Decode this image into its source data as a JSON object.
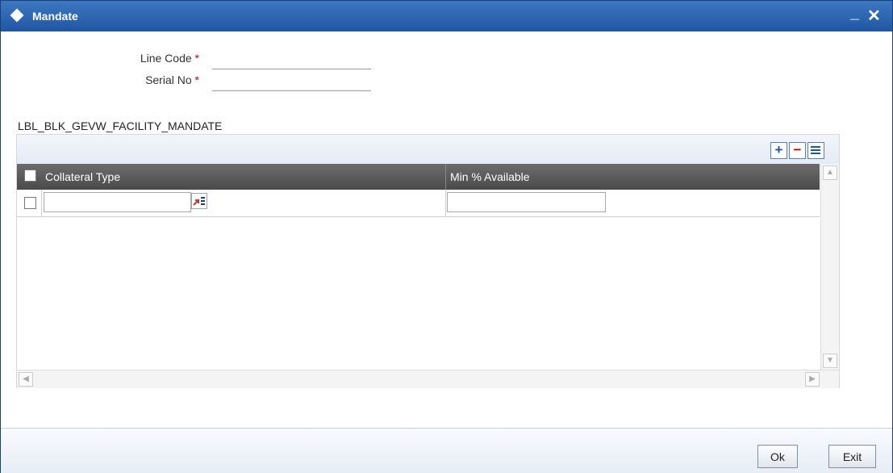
{
  "window": {
    "title": "Mandate",
    "minimize_glyph": "_",
    "close_glyph": "✕"
  },
  "form": {
    "line_code_label": "Line Code",
    "line_code_value": "",
    "serial_no_label": "Serial No",
    "serial_no_value": "",
    "required_mark": "*"
  },
  "grid": {
    "section_title": "LBL_BLK_GEVW_FACILITY_MANDATE",
    "add_glyph": "+",
    "delete_glyph": "−",
    "columns": [
      "Collateral Type",
      "Min % Available"
    ],
    "rows": [
      {
        "collateral_type": "",
        "min_available": ""
      }
    ],
    "scroll": {
      "up": "▲",
      "down": "▼",
      "left": "◀",
      "right": "▶"
    }
  },
  "footer": {
    "ok_label": "Ok",
    "exit_label": "Exit"
  },
  "colors": {
    "title_bar": "#1f56a3",
    "grid_header": "#555555",
    "required": "#cc0000",
    "lov_icon": "#c0392b"
  }
}
